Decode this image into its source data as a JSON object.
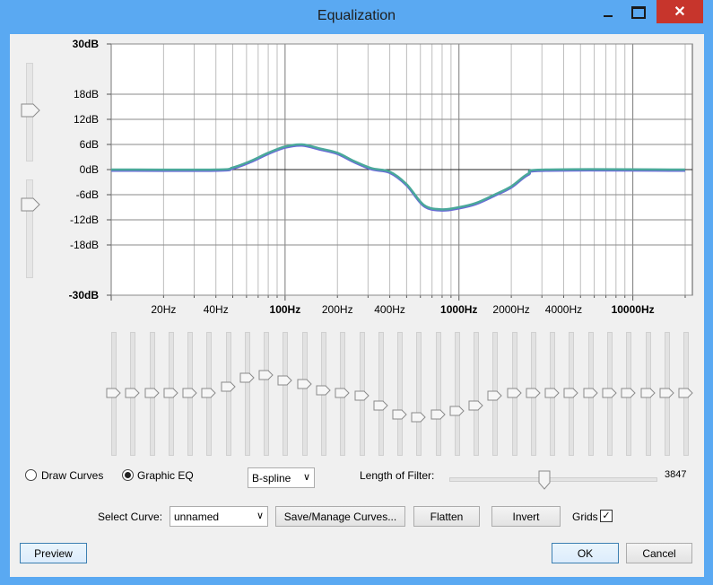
{
  "window": {
    "title": "Equalization",
    "close_glyph": "✕"
  },
  "chart_data": {
    "type": "line",
    "yticks": [
      "30dB",
      "18dB",
      "12dB",
      "6dB",
      "0dB",
      "-6dB",
      "-12dB",
      "-18dB",
      "-30dB"
    ],
    "ytick_values": [
      30,
      18,
      12,
      6,
      0,
      -6,
      -12,
      -18,
      -30
    ],
    "ylim": [
      -30,
      30
    ],
    "xscale": "log",
    "xlim": [
      10,
      22000
    ],
    "xticks": [
      {
        "label": "20Hz",
        "value": 20,
        "bold": false
      },
      {
        "label": "40Hz",
        "value": 40,
        "bold": false
      },
      {
        "label": "100Hz",
        "value": 100,
        "bold": true
      },
      {
        "label": "200Hz",
        "value": 200,
        "bold": false
      },
      {
        "label": "400Hz",
        "value": 400,
        "bold": false
      },
      {
        "label": "1000Hz",
        "value": 1000,
        "bold": true
      },
      {
        "label": "2000Hz",
        "value": 2000,
        "bold": false
      },
      {
        "label": "4000Hz",
        "value": 4000,
        "bold": false
      },
      {
        "label": "10000Hz",
        "value": 10000,
        "bold": true
      }
    ],
    "grid": true,
    "series": [
      {
        "color": "#4aa89a",
        "x": [
          10,
          40,
          50,
          63,
          80,
          100,
          125,
          160,
          200,
          250,
          315,
          400,
          500,
          630,
          800,
          1000,
          1250,
          1600,
          2000,
          2500,
          3150,
          20000
        ],
        "y": [
          0,
          0,
          0.5,
          2,
          4,
          5.5,
          6,
          5,
          4,
          2,
          0.3,
          -0.5,
          -3.5,
          -8.5,
          -9.5,
          -9,
          -8,
          -6,
          -4,
          -1,
          0,
          0
        ]
      }
    ]
  },
  "sliders": {
    "bands": [
      0,
      0,
      0,
      0,
      0,
      0,
      2,
      5,
      6,
      4,
      3,
      1,
      0,
      -1,
      -4,
      -7,
      -8,
      -7,
      -6,
      -4,
      -1,
      0,
      0,
      0,
      0,
      0,
      0,
      0,
      0,
      0,
      0
    ],
    "band_range": [
      -20,
      20
    ]
  },
  "mode": {
    "draw_curves": "Draw Curves",
    "graphic_eq": "Graphic EQ",
    "selected": "graphic_eq"
  },
  "interp": {
    "value": "B-spline",
    "arrow": "∨"
  },
  "filter": {
    "label": "Length of Filter:",
    "value": "3847",
    "position": 0.5
  },
  "curve": {
    "label": "Select Curve:",
    "value": "unnamed",
    "arrow": "∨"
  },
  "buttons": {
    "save_manage": "Save/Manage Curves...",
    "flatten": "Flatten",
    "invert": "Invert",
    "preview": "Preview",
    "ok": "OK",
    "cancel": "Cancel"
  },
  "grids": {
    "label": "Grids",
    "checked": "✓"
  }
}
